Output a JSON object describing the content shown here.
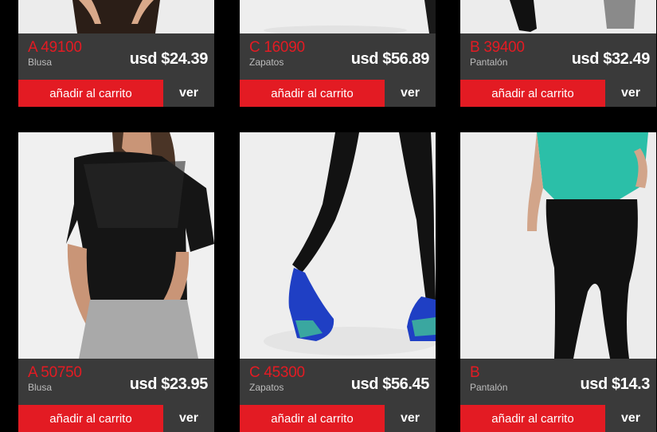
{
  "products": [
    {
      "code": "A 49100",
      "category": "Blusa",
      "price": "usd $24.39",
      "cart_label": "añadir al carrito",
      "view_label": "ver"
    },
    {
      "code": "C 16090",
      "category": "Zapatos",
      "price": "usd $56.89",
      "cart_label": "añadir al carrito",
      "view_label": "ver"
    },
    {
      "code": "B 39400",
      "category": "Pantalón",
      "price": "usd $32.49",
      "cart_label": "añadir al carrito",
      "view_label": "ver"
    },
    {
      "code": "A 50750",
      "category": "Blusa",
      "price": "usd $23.95",
      "cart_label": "añadir al carrito",
      "view_label": "ver"
    },
    {
      "code": "C 45300",
      "category": "Zapatos",
      "price": "usd $56.45",
      "cart_label": "añadir al carrito",
      "view_label": "ver"
    },
    {
      "code": "B",
      "category": "Pantalón",
      "price": "usd $14.3",
      "cart_label": "añadir al carrito",
      "view_label": "ver"
    }
  ],
  "colors": {
    "accent": "#e31b23",
    "panel": "#3a3a3a",
    "background": "#000000"
  }
}
